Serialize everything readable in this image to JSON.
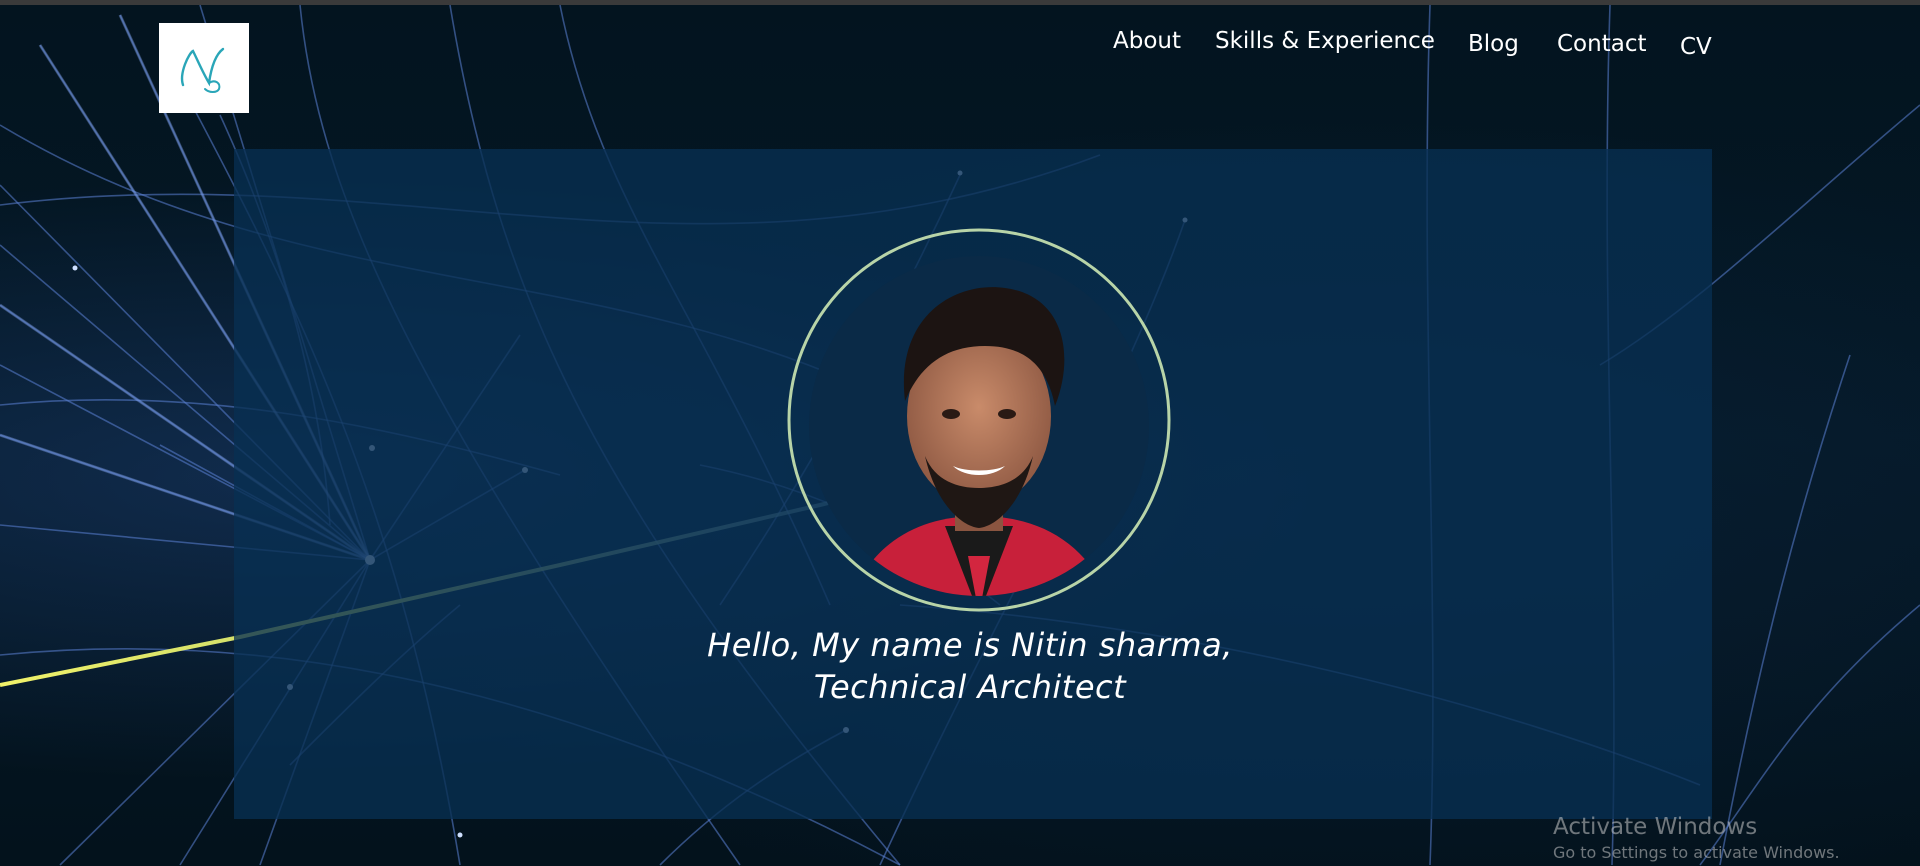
{
  "logo": {
    "monogram": "N"
  },
  "nav": {
    "items": [
      {
        "label": "About"
      },
      {
        "label": "Skills & Experience"
      },
      {
        "label": "Blog"
      },
      {
        "label": "Contact"
      },
      {
        "label": "CV"
      }
    ]
  },
  "hero": {
    "line1": "Hello, My name is Nitin sharma,",
    "line2": "Technical Architect"
  },
  "watermark": {
    "title": "Activate Windows",
    "subtitle": "Go to Settings to activate Windows."
  },
  "colors": {
    "page_bg": "#02101a",
    "panel_bg": "#083052",
    "ring": "#b8d4a8",
    "logo_teal": "#2aa6b8",
    "nav_text": "#ffffff"
  }
}
